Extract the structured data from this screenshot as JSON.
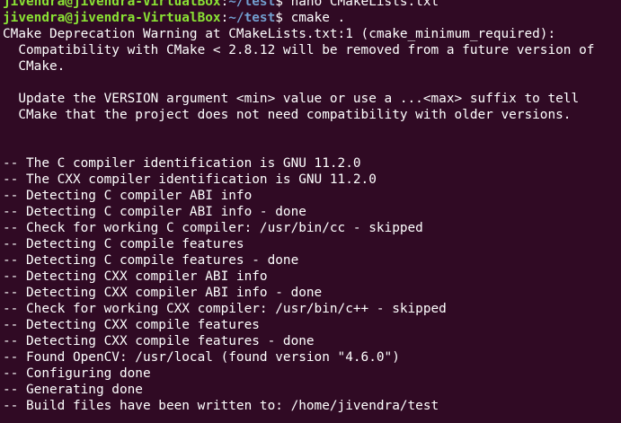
{
  "colors": {
    "background": "#300a24",
    "text": "#ffffff",
    "prompt_user": "#8ae234",
    "prompt_path": "#729fcf"
  },
  "prompt": {
    "user_host": "jivendra@jivendra-VirtualBox",
    "separator": ":",
    "path": "~/test",
    "symbol": "$ "
  },
  "commands": {
    "nano": "nano CMakeLists.txt",
    "cmake": "cmake ."
  },
  "warning": {
    "line1": "CMake Deprecation Warning at CMakeLists.txt:1 (cmake_minimum_required):",
    "line2": "  Compatibility with CMake < 2.8.12 will be removed from a future version of",
    "line3": "  CMake.",
    "line4": "",
    "line5": "  Update the VERSION argument <min> value or use a ...<max> suffix to tell",
    "line6": "  CMake that the project does not need compatibility with older versions.",
    "line7": "",
    "line8": ""
  },
  "output": [
    "-- The C compiler identification is GNU 11.2.0",
    "-- The CXX compiler identification is GNU 11.2.0",
    "-- Detecting C compiler ABI info",
    "-- Detecting C compiler ABI info - done",
    "-- Check for working C compiler: /usr/bin/cc - skipped",
    "-- Detecting C compile features",
    "-- Detecting C compile features - done",
    "-- Detecting CXX compiler ABI info",
    "-- Detecting CXX compiler ABI info - done",
    "-- Check for working CXX compiler: /usr/bin/c++ - skipped",
    "-- Detecting CXX compile features",
    "-- Detecting CXX compile features - done",
    "-- Found OpenCV: /usr/local (found version \"4.6.0\")",
    "-- Configuring done",
    "-- Generating done",
    "-- Build files have been written to: /home/jivendra/test"
  ]
}
